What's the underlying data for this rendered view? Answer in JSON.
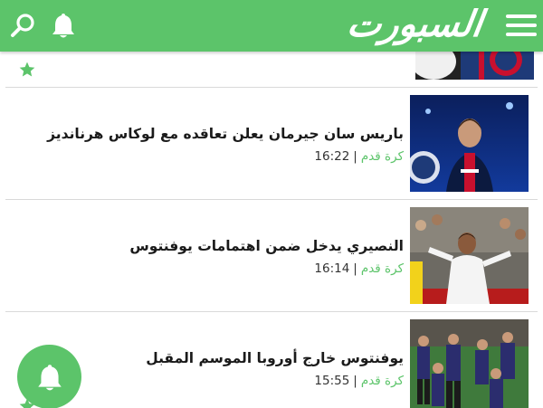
{
  "app": {
    "logo_text": "السبورت",
    "accent_color": "#5cc46a"
  },
  "header": {
    "icons": [
      "search-icon",
      "bell-icon",
      "menu-icon"
    ]
  },
  "articles": [
    {
      "title": "",
      "category": "",
      "time": ""
    },
    {
      "title": "باريس سان جيرمان يعلن تعاقده مع لوكاس هرنانديز",
      "category": "كرة قدم",
      "time": "16:22"
    },
    {
      "title": "النصيري يدخل ضمن اهتمامات يوفنتوس",
      "category": "كرة قدم",
      "time": "16:14"
    },
    {
      "title": "يوفنتوس خارج أوروبا الموسم المقبل",
      "category": "كرة قدم",
      "time": "15:55"
    }
  ],
  "floating_button": {
    "icon": "bell-icon"
  }
}
